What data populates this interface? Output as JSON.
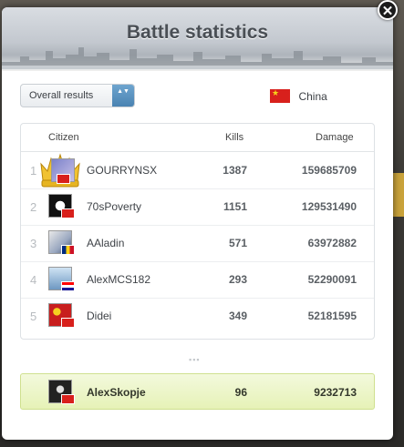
{
  "modal": {
    "title": "Battle statistics",
    "close_glyph": "✕"
  },
  "filter": {
    "label": "Overall results",
    "arrows": "▲▼"
  },
  "country": {
    "name": "China",
    "flag_icon": "china-flag-icon"
  },
  "table": {
    "headers": {
      "citizen": "Citizen",
      "kills": "Kills",
      "damage": "Damage"
    },
    "rows": [
      {
        "rank": "1",
        "name": "GOURRYNSX",
        "kills": "1387",
        "damage": "159685709",
        "flag": "china"
      },
      {
        "rank": "2",
        "name": "70sPoverty",
        "kills": "1151",
        "damage": "129531490",
        "flag": "china"
      },
      {
        "rank": "3",
        "name": "AAladin",
        "kills": "571",
        "damage": "63972882",
        "flag": "romania"
      },
      {
        "rank": "4",
        "name": "AlexMCS182",
        "kills": "293",
        "damage": "52290091",
        "flag": "croatia"
      },
      {
        "rank": "5",
        "name": "Didei",
        "kills": "349",
        "damage": "52181595",
        "flag": "china"
      }
    ]
  },
  "separator": "▪▪▪",
  "current_user": {
    "name": "AlexSkopje",
    "kills": "96",
    "damage": "9232713",
    "flag": "china"
  },
  "colors": {
    "accent": "#4a83b2",
    "highlight": "#e6f2b7",
    "china_red": "#d8201c"
  }
}
